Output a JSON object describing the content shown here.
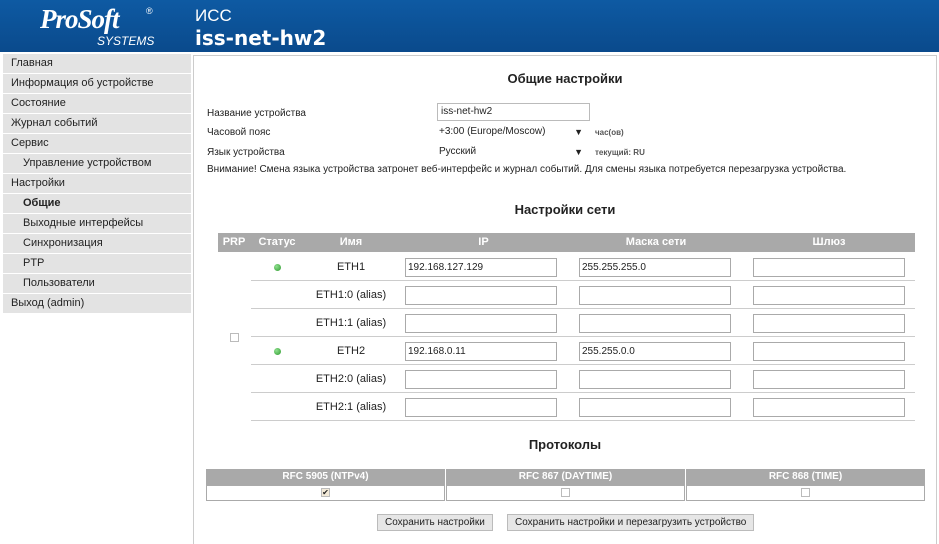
{
  "header": {
    "logo_main": "ProSoft",
    "logo_reg": "®",
    "logo_sub": "SYSTEMS",
    "title": "ИСС",
    "subtitle": "iss-net-hw2",
    "bg_color": "#0b4f96"
  },
  "sidebar": {
    "items": [
      {
        "label": "Главная",
        "sub": false,
        "active": false
      },
      {
        "label": "Информация об устройстве",
        "sub": false,
        "active": false
      },
      {
        "label": "Состояние",
        "sub": false,
        "active": false
      },
      {
        "label": "Журнал событий",
        "sub": false,
        "active": false
      },
      {
        "label": "Сервис",
        "sub": false,
        "active": false
      },
      {
        "label": "Управление устройством",
        "sub": true,
        "active": false
      },
      {
        "label": "Настройки",
        "sub": false,
        "active": false
      },
      {
        "label": "Общие",
        "sub": true,
        "active": true
      },
      {
        "label": "Выходные интерфейсы",
        "sub": true,
        "active": false
      },
      {
        "label": "Синхронизация",
        "sub": true,
        "active": false
      },
      {
        "label": "PTP",
        "sub": true,
        "active": false
      },
      {
        "label": "Пользователи",
        "sub": true,
        "active": false
      },
      {
        "label": "Выход (admin)",
        "sub": false,
        "active": false
      }
    ]
  },
  "general": {
    "title": "Общие настройки",
    "device_name_label": "Название устройства",
    "device_name_value": "iss-net-hw2",
    "timezone_label": "Часовой пояс",
    "timezone_value": "+3:00 (Europe/Moscow)",
    "timezone_hint": "час(ов)",
    "language_label": "Язык устройства",
    "language_value": "Русский",
    "language_hint": "текущий: RU",
    "warning": "Внимание! Смена языка устройства затронет веб-интерфейс и журнал событий. Для смены языка потребуется перезагрузка устройства."
  },
  "network": {
    "title": "Настройки сети",
    "columns": [
      "PRP",
      "Статус",
      "Имя",
      "IP",
      "Маска сети",
      "Шлюз"
    ],
    "prp_checked": false,
    "rows": [
      {
        "name": "ETH1",
        "status": "up",
        "ip": "192.168.127.129",
        "mask": "255.255.255.0",
        "gateway": ""
      },
      {
        "name": "ETH1:0 (alias)",
        "status": "",
        "ip": "",
        "mask": "",
        "gateway": ""
      },
      {
        "name": "ETH1:1 (alias)",
        "status": "",
        "ip": "",
        "mask": "",
        "gateway": ""
      },
      {
        "name": "ETH2",
        "status": "up",
        "ip": "192.168.0.11",
        "mask": "255.255.0.0",
        "gateway": ""
      },
      {
        "name": "ETH2:0 (alias)",
        "status": "",
        "ip": "",
        "mask": "",
        "gateway": ""
      },
      {
        "name": "ETH2:1 (alias)",
        "status": "",
        "ip": "",
        "mask": "",
        "gateway": ""
      }
    ]
  },
  "protocols": {
    "title": "Протоколы",
    "items": [
      {
        "label": "RFC 5905 (NTPv4)",
        "checked": true
      },
      {
        "label": "RFC 867 (DAYTIME)",
        "checked": false
      },
      {
        "label": "RFC 868 (TIME)",
        "checked": false
      }
    ]
  },
  "buttons": {
    "save": "Сохранить настройки",
    "save_reboot": "Сохранить настройки и перезагрузить устройство"
  }
}
